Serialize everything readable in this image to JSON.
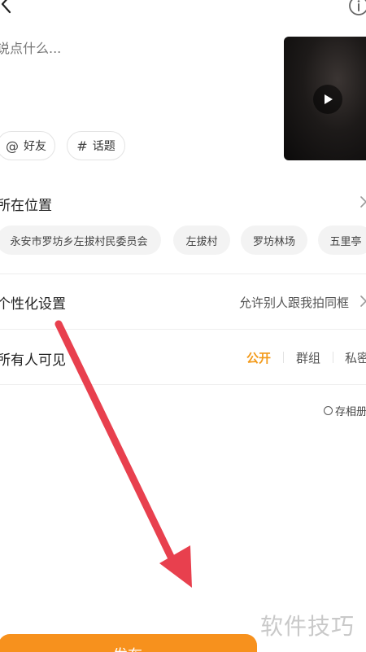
{
  "header": {
    "back_icon": "chevron-left-icon",
    "info_icon": "info-icon"
  },
  "compose": {
    "placeholder": "说点什么...",
    "video_icon": "play-icon"
  },
  "chips": {
    "friend": {
      "icon": "at-icon",
      "glyph": "@",
      "label": "好友"
    },
    "topic": {
      "icon": "hashtag-icon",
      "glyph": "#",
      "label": "话题"
    }
  },
  "location": {
    "title": "所在位置",
    "options": [
      "永安市罗坊乡左拔村民委员会",
      "左拔村",
      "罗坊林场",
      "五里亭"
    ]
  },
  "personalization": {
    "title": "个性化设置",
    "value": "允许别人跟我拍同框"
  },
  "visibility": {
    "title": "所有人可见",
    "options": [
      "公开",
      "群组",
      "私密"
    ],
    "selected": "公开"
  },
  "save_album": {
    "label": "存相册"
  },
  "publish": {
    "label": "发布"
  },
  "watermark": "软件技巧",
  "colors": {
    "accent": "#f7911d",
    "annotation_arrow": "#e8404e"
  }
}
